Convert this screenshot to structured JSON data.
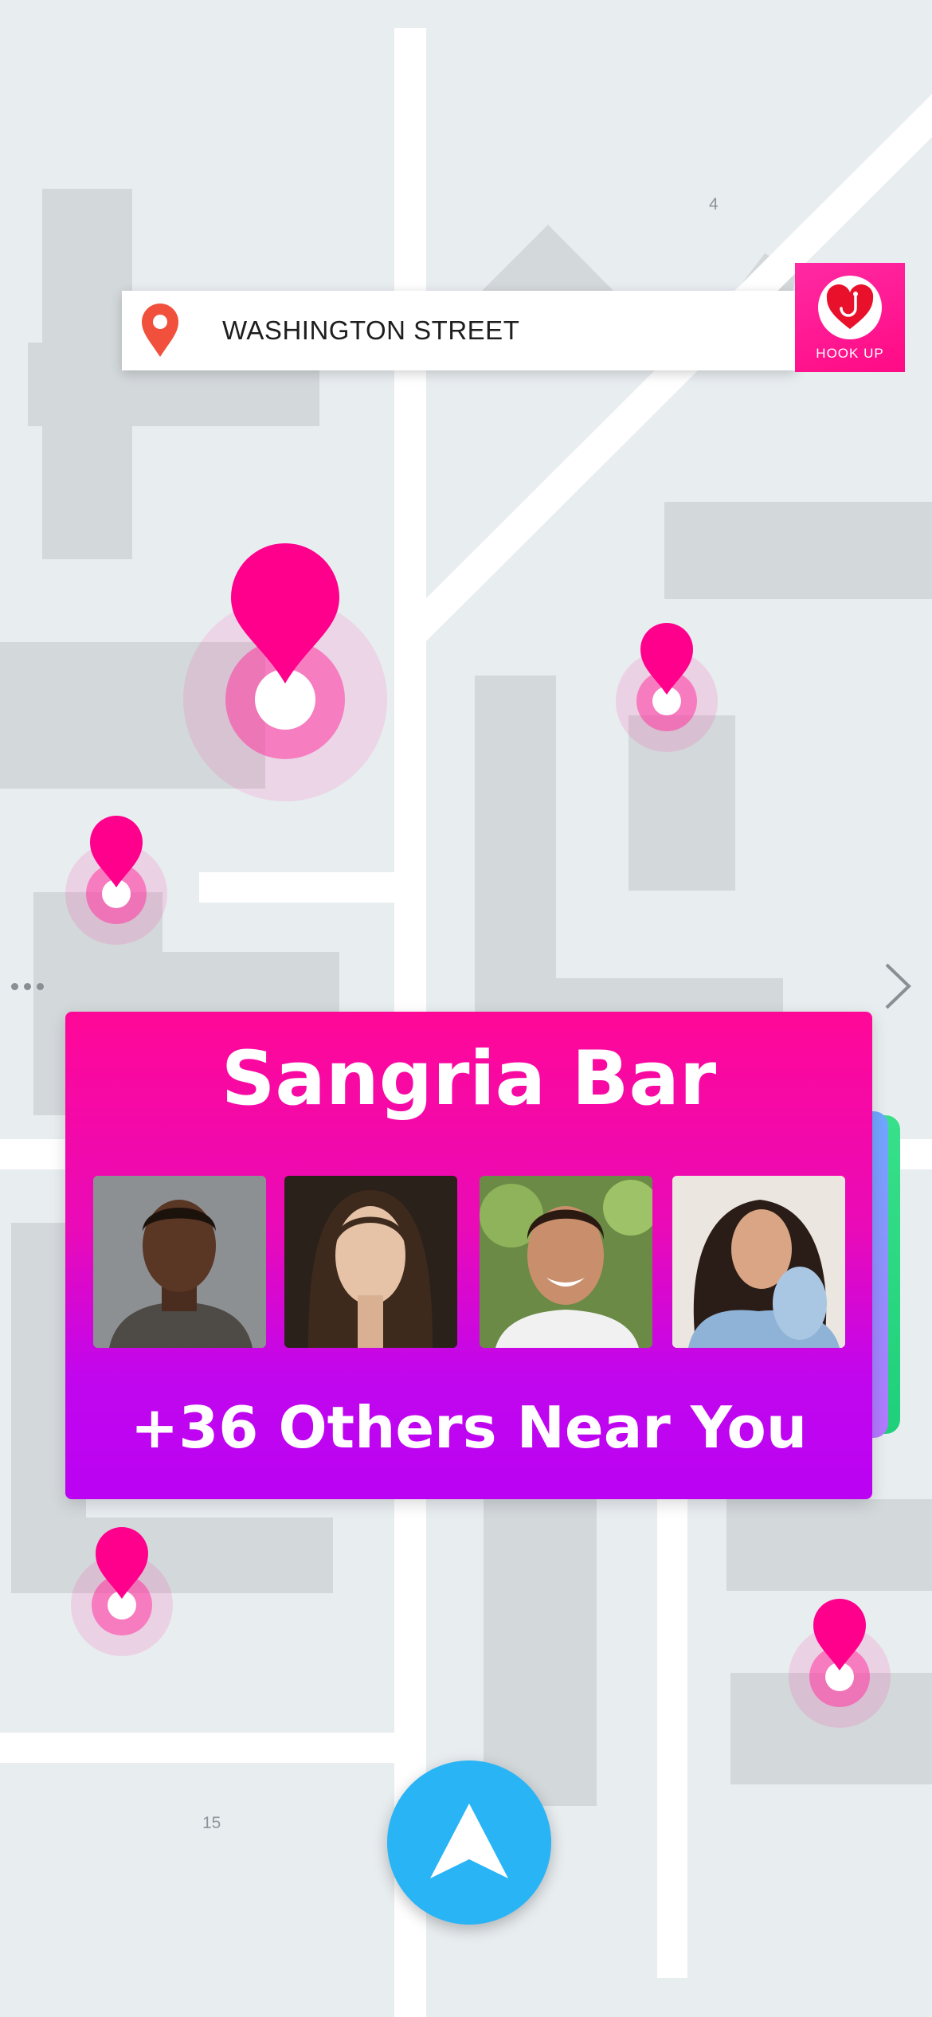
{
  "search": {
    "street": "WASHINGTON STREET"
  },
  "logo": {
    "text": "HOOK UP"
  },
  "map": {
    "block_numbers": [
      "4",
      "15"
    ]
  },
  "venue": {
    "name": "Sangria Bar",
    "others_text": "+36 Others Near You",
    "profiles": [
      "profile-1",
      "profile-2",
      "profile-3",
      "profile-4"
    ]
  },
  "colors": {
    "accent": "#ff0a8c",
    "card_top": "#ff0898",
    "card_bottom": "#bb02f2",
    "nav_button": "#29b4f6",
    "map_bg": "#e8edf0",
    "block": "#d3d8db"
  }
}
